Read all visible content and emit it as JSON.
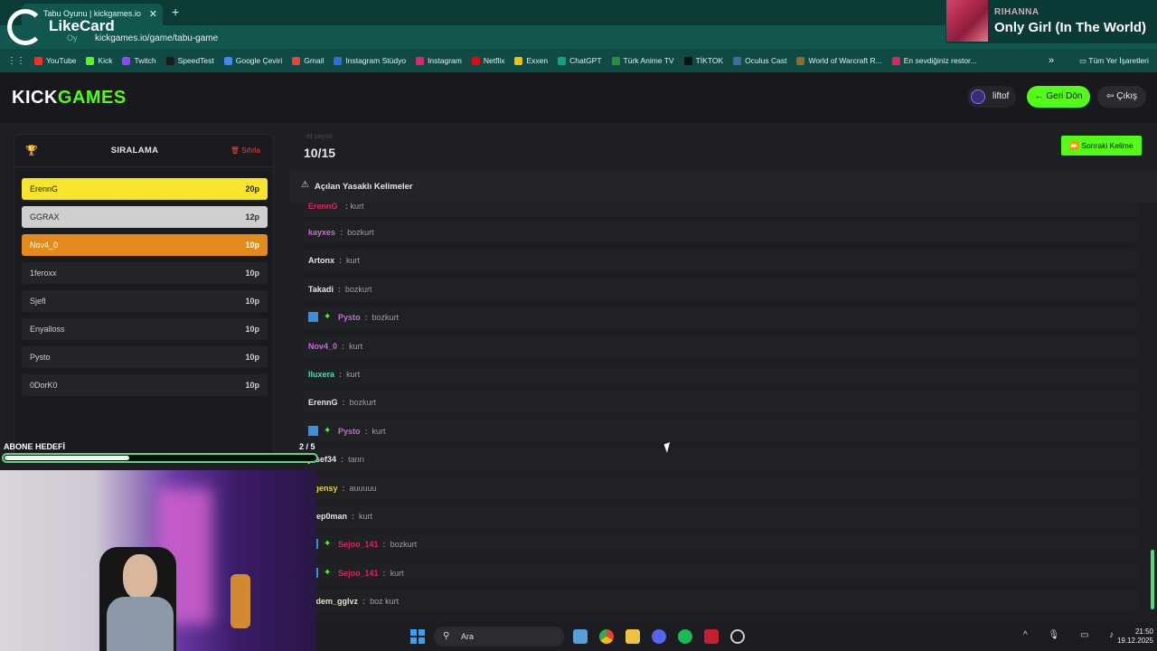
{
  "browser": {
    "tab_title": "Tabu Oyunu | kickgames.io",
    "url_prefix": "Oy",
    "url": "kickgames.io/game/tabu-game",
    "bookmarks": [
      {
        "label": "YouTube",
        "color": "#ff2a2a"
      },
      {
        "label": "Kick",
        "color": "#53fc18"
      },
      {
        "label": "Twitch",
        "color": "#9146ff"
      },
      {
        "label": "SpeedTest",
        "color": "#1b1b1b"
      },
      {
        "label": "Google Çeviri",
        "color": "#4285f4"
      },
      {
        "label": "Gmail",
        "color": "#ea4335"
      },
      {
        "label": "Instagram Stüdyo",
        "color": "#2f6fd6"
      },
      {
        "label": "Instagram",
        "color": "#d62976"
      },
      {
        "label": "Netflix",
        "color": "#e50914"
      },
      {
        "label": "Exxen",
        "color": "#f2c200"
      },
      {
        "label": "ChatGPT",
        "color": "#10a37f"
      },
      {
        "label": "Türk Anime TV",
        "color": "#2a8f3a"
      },
      {
        "label": "TİKTOK",
        "color": "#111111"
      },
      {
        "label": "Oculus Cast",
        "color": "#3a6ea5"
      },
      {
        "label": "World of Warcraft R...",
        "color": "#8a6d2c"
      },
      {
        "label": "En sevdiğiniz restor...",
        "color": "#e0245e"
      }
    ],
    "all_bookmarks": "Tüm Yer İşaretleri"
  },
  "overlay": {
    "likecard": "LikeCard",
    "np_artist": "RIHANNA",
    "np_title": "Only Girl (In The World)",
    "goal_label": "ABONE HEDEFİ",
    "goal_count": "2 / 5",
    "goal_progress": 0.4
  },
  "site": {
    "logo_kick": "KICK",
    "logo_games": "GAMES",
    "username": "liftof",
    "back_label": "Geri Dön",
    "exit_label": "Çıkış"
  },
  "leaderboard": {
    "title": "SIRALAMA",
    "reset": "Sıfırla",
    "rows": [
      {
        "name": "ErennG",
        "points": "20p",
        "bg": "#f6e52c",
        "fg": "#2a2406"
      },
      {
        "name": "GGRAX",
        "points": "12p",
        "bg": "#cfcfcf",
        "fg": "#2a2a2a"
      },
      {
        "name": "Nov4_0",
        "points": "10p",
        "bg": "#e38a1c",
        "fg": "#ffffff"
      },
      {
        "name": "1feroxx",
        "points": "10p",
        "bg": "#232428",
        "fg": "#cfcfcf"
      },
      {
        "name": "Sjefl",
        "points": "10p",
        "bg": "#232428",
        "fg": "#cfcfcf"
      },
      {
        "name": "Enyalloss",
        "points": "10p",
        "bg": "#232428",
        "fg": "#cfcfcf"
      },
      {
        "name": "Pysto",
        "points": "10p",
        "bg": "#232428",
        "fg": "#cfcfcf"
      },
      {
        "name": "0DorK0",
        "points": "10p",
        "bg": "#232428",
        "fg": "#cfcfcf"
      }
    ]
  },
  "game": {
    "round_label": "el sayısı",
    "round": "10/15",
    "next_word": "Sonraki Kelime",
    "banned_title": "Açılan Yasaklı Kelimeler",
    "messages": [
      {
        "user": "kayxes",
        "color": "#c86bd6",
        "text": "bozkurt",
        "badges": false
      },
      {
        "user": "Artonx",
        "color": "#e6e6e6",
        "text": "kurt",
        "badges": false
      },
      {
        "user": "Takadi",
        "color": "#e6e6e6",
        "text": "bozkurt",
        "badges": false
      },
      {
        "user": "Pysto",
        "color": "#c86bd6",
        "text": "bozkurt",
        "badges": true
      },
      {
        "user": "Nov4_0",
        "color": "#c86bd6",
        "text": "kurt",
        "badges": false
      },
      {
        "user": "Iluxera",
        "color": "#5fd0b8",
        "text": "kurt",
        "badges": false
      },
      {
        "user": "ErennG",
        "color": "#e6e6e6",
        "text": "bozkurt",
        "badges": false
      },
      {
        "user": "Pysto",
        "color": "#c86bd6",
        "text": "kurt",
        "badges": true
      },
      {
        "user": "josef34",
        "color": "#e6e6e6",
        "text": "tanrı",
        "badges": false
      },
      {
        "user": "Ugensy",
        "color": "#e8d24a",
        "text": "auuuuu",
        "badges": false
      },
      {
        "user": "Step0man",
        "color": "#e6e6e6",
        "text": "kurt",
        "badges": false
      },
      {
        "user": "Sejoo_141",
        "color": "#e0245e",
        "text": "bozkurt",
        "badges": true
      },
      {
        "user": "Sejoo_141",
        "color": "#e0245e",
        "text": "kurt",
        "badges": true
      },
      {
        "user": "erdem_gglvz",
        "color": "#e8e4c8",
        "text": "boz kurt",
        "badges": false
      }
    ],
    "partial_first": {
      "user": "ErennG",
      "text": "kurt"
    }
  },
  "taskbar": {
    "search": "Ara",
    "time": "21:50",
    "date": "19.12.2025"
  }
}
